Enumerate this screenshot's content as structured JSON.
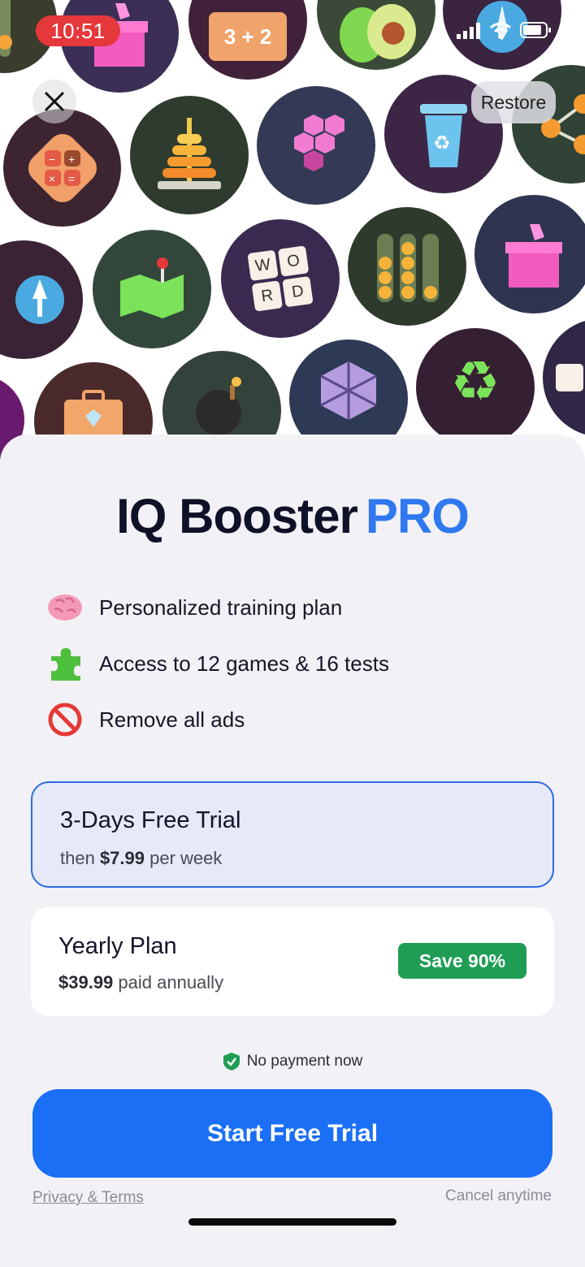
{
  "status_bar": {
    "time": "10:51"
  },
  "header": {
    "restore_label": "Restore"
  },
  "title": {
    "main": "IQ Booster",
    "pro": "PRO"
  },
  "features": [
    {
      "icon": "brain-icon",
      "label": "Personalized training plan"
    },
    {
      "icon": "puzzle-piece-icon",
      "label": "Access to 12 games & 16 tests"
    },
    {
      "icon": "no-entry-icon",
      "label": "Remove all ads"
    }
  ],
  "plans": [
    {
      "title": "3-Days Free Trial",
      "price_prefix": "then ",
      "price": "$7.99",
      "price_suffix": " per week",
      "selected": true
    },
    {
      "title": "Yearly Plan",
      "price_prefix": "",
      "price": "$39.99",
      "price_suffix": " paid annually",
      "badge": "Save 90%",
      "selected": false
    }
  ],
  "no_payment_label": "No payment now",
  "cta_label": "Start Free Trial",
  "footer": {
    "privacy_label": "Privacy & Terms",
    "cancel_label": "Cancel anytime"
  },
  "hero_tiles": {
    "math_label": "3 + 2",
    "word_tile": [
      "W",
      "O",
      "R",
      "D"
    ]
  },
  "colors": {
    "accent": "#1a6ff5",
    "pro": "#2f78f0",
    "save_badge": "#1f9d55",
    "time_pill": "#e5383b"
  }
}
